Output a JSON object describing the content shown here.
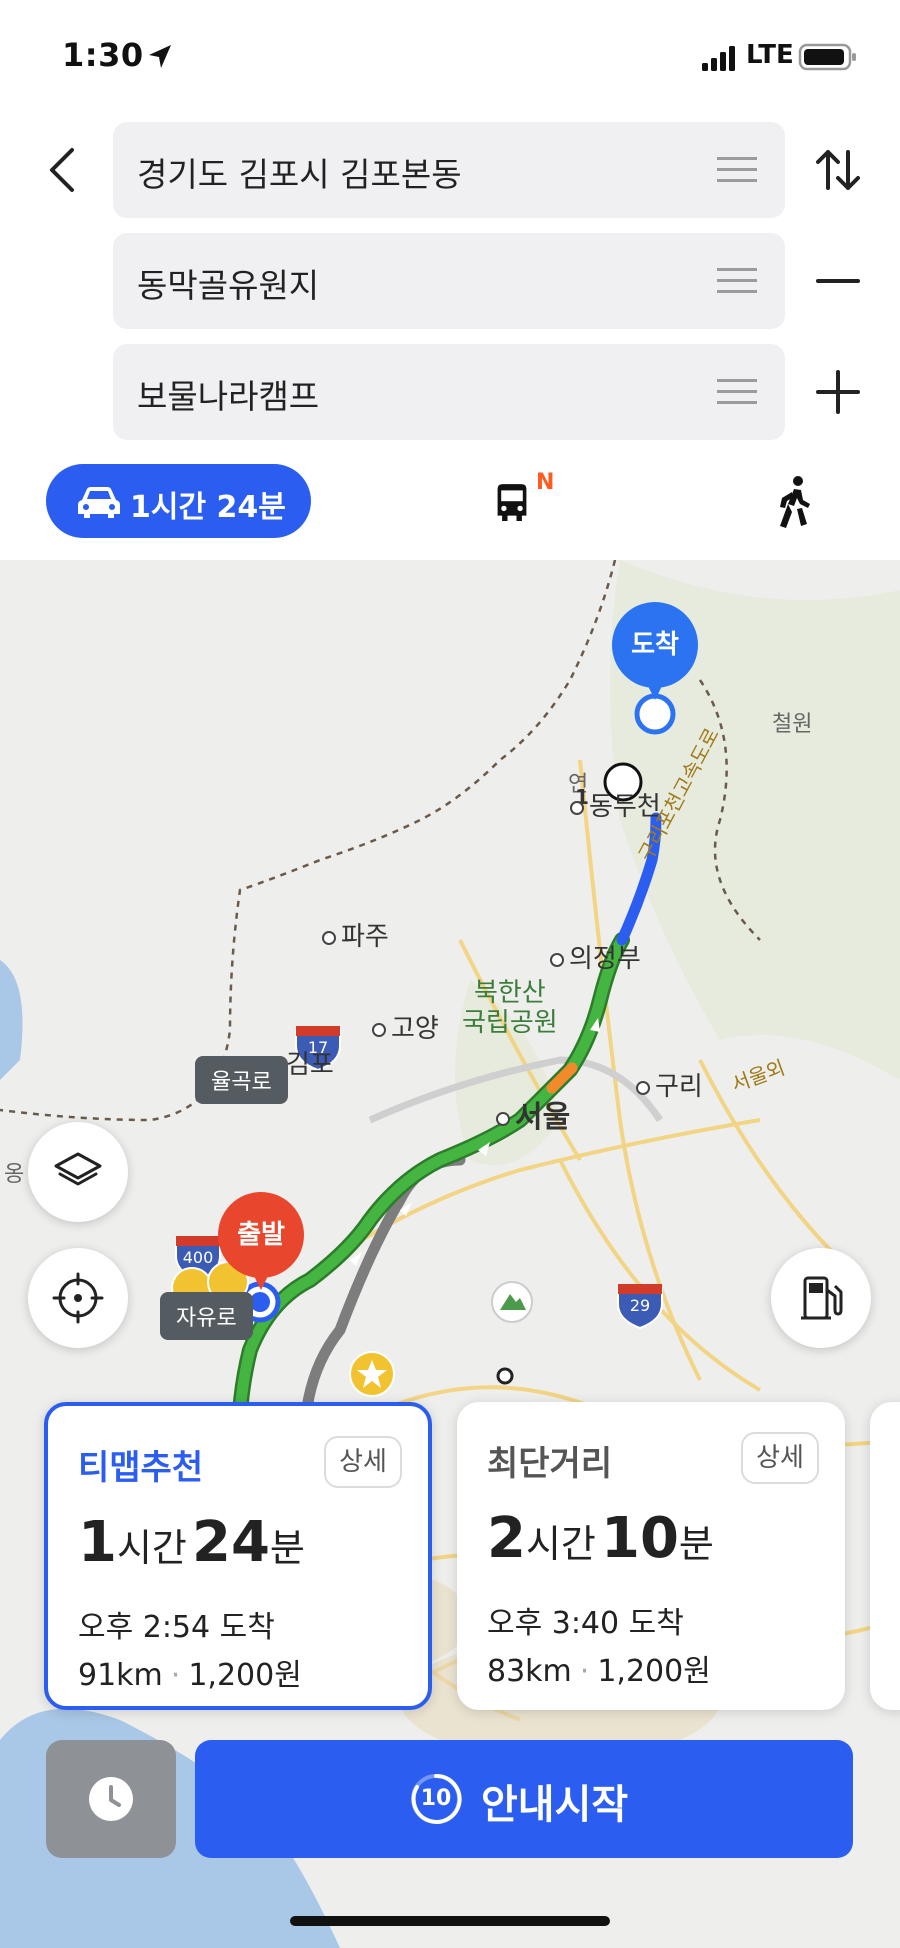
{
  "status_bar": {
    "time": "1:30",
    "network": "LTE"
  },
  "route_inputs": {
    "origin": "경기도 김포시 김포본동",
    "waypoint": "동막골유원지",
    "destination": "보물나라캠프"
  },
  "mode_tabs": {
    "car_time": "1시간 24분",
    "bus_badge": "N"
  },
  "map": {
    "pins": {
      "arrive": "도착",
      "depart": "출발"
    },
    "road_tags": {
      "yulgok": "율곡로",
      "jayu": "자유로"
    },
    "waypoint_marker": "1",
    "places": {
      "cheorwon": "철원",
      "yeoncheon_partial": "연",
      "dongducheon": "동두천",
      "paju": "파주",
      "uijeongbu": "의정부",
      "bukhansan": "북한산\n국립공원",
      "goyang": "고양",
      "gimpo": "김포",
      "guri": "구리",
      "seoul": "서울",
      "guri_pocheon_expressway": "구리포천고속도로",
      "seoul_ring_partial": "서울외",
      "ong_partial": "옹"
    },
    "route_shields": {
      "r400": "400",
      "r17": "17",
      "r29": "29"
    }
  },
  "route_cards": [
    {
      "title": "티맵추천",
      "detail": "상세",
      "hours": "1",
      "hours_unit": "시간",
      "minutes": "24",
      "minutes_unit": "분",
      "arrival": "오후 2:54 도착",
      "distance": "91km",
      "toll": "1,200원"
    },
    {
      "title": "최단거리",
      "detail": "상세",
      "hours": "2",
      "hours_unit": "시간",
      "minutes": "10",
      "minutes_unit": "분",
      "arrival": "오후 3:40 도착",
      "distance": "83km",
      "toll": "1,200원"
    }
  ],
  "bottom": {
    "countdown": "10",
    "start_label": "안내시작"
  },
  "colors": {
    "accent": "#2b5ef0",
    "route_green": "#3fae3a",
    "arrive_pin": "#2b73f0",
    "depart_pin": "#e8472e"
  }
}
